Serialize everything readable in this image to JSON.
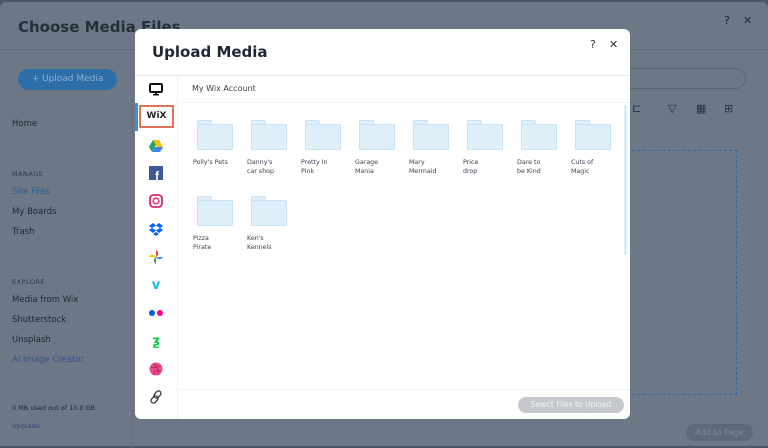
{
  "background": {
    "title": "Choose Media Files",
    "help_icon": "?",
    "close_icon": "✕",
    "upload_button": "+ Upload Media",
    "sidebar": {
      "home": "Home",
      "manage_heading": "MANAGE",
      "manage_items": [
        "Site Files",
        "My Boards",
        "Trash"
      ],
      "explore_heading": "EXPLORE",
      "explore_items": [
        "Media from Wix",
        "Shutterstock",
        "Unsplash",
        "AI Image Creator"
      ],
      "storage": "0 MB used out of 10.0 GB",
      "upgrade": "Upgrade"
    },
    "add_to_page": "Add to Page"
  },
  "dialog": {
    "title": "Upload Media",
    "help_icon": "?",
    "close_icon": "✕",
    "sources": [
      "computer",
      "wix",
      "google-drive",
      "facebook",
      "instagram",
      "dropbox",
      "google-photos",
      "vimeo",
      "flickr",
      "deviantart",
      "dribbble",
      "link"
    ],
    "wix_label": "WiX",
    "selected_source": "wix",
    "location": "My Wix Account",
    "folders": [
      [
        "Polly's Pets",
        ""
      ],
      [
        "Danny's",
        "car shop"
      ],
      [
        "Pretty In",
        "Pink"
      ],
      [
        "Garage",
        "Mania"
      ],
      [
        "Mary",
        "Mermaid"
      ],
      [
        "Price",
        "drop"
      ],
      [
        "Dare to",
        "be Kind"
      ],
      [
        "Cuts of",
        "Magic"
      ],
      [
        "Pizza",
        "Pirate"
      ],
      [
        "Ken's",
        "Kennels"
      ]
    ],
    "select_button": "Select Files to Upload"
  },
  "colors": {
    "accent": "#3b8ee0",
    "wix_highlight": "#e0735a",
    "folder": "#dff0fb"
  }
}
